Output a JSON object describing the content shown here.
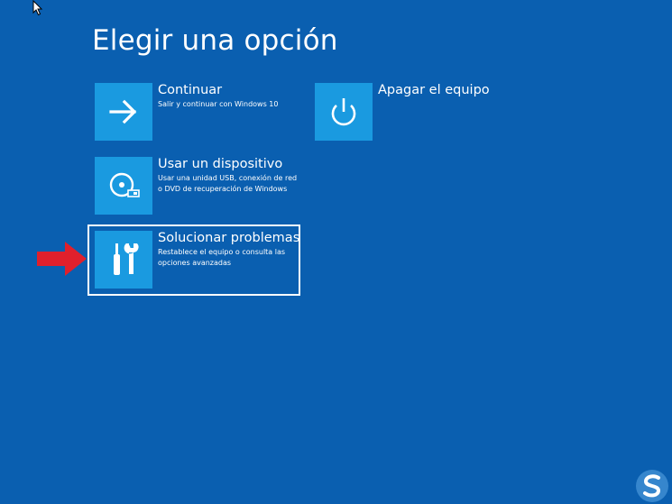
{
  "title": "Elegir una opción",
  "options": {
    "continue": {
      "label": "Continuar",
      "description": "Salir y continuar con Windows 10",
      "icon": "arrow-right-icon"
    },
    "shutdown": {
      "label": "Apagar el equipo",
      "icon": "power-icon"
    },
    "device": {
      "label": "Usar un dispositivo",
      "description": "Usar una unidad USB, conexión de red o DVD de recuperación de Windows",
      "icon": "disc-drive-icon"
    },
    "troubleshoot": {
      "label": "Solucionar problemas",
      "description": "Restablece el equipo o consulta las opciones avanzadas",
      "icon": "tools-icon"
    }
  },
  "colors": {
    "background": "#0a5fb0",
    "tile": "#1a9ae0",
    "text": "#ffffff",
    "annotation_arrow": "#e0202c"
  }
}
